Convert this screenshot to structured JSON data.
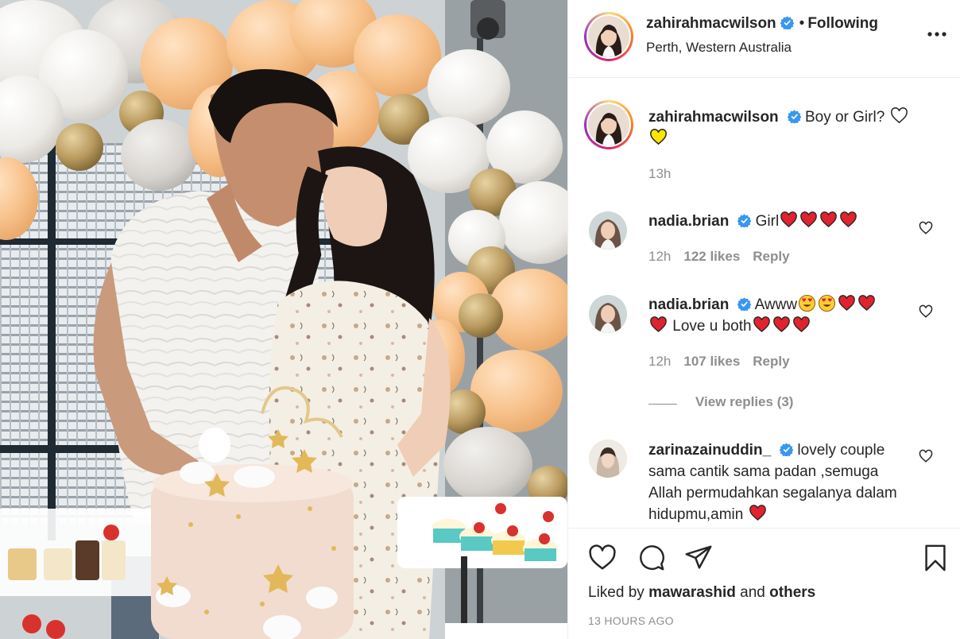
{
  "post": {
    "image_alt": "Couple embracing beside a pastel baby-shower cake and balloon garland"
  },
  "header": {
    "username": "zahirahmacwilson",
    "verified": true,
    "separator": "•",
    "follow_label": "Following",
    "location": "Perth, Western Australia",
    "more_icon": "more-horizontal-icon"
  },
  "caption": {
    "username": "zahirahmacwilson",
    "text": "Boy or Girl?",
    "emojis": [
      "white-heart",
      "yellow-heart"
    ],
    "time": "13h"
  },
  "comments": [
    {
      "username": "nadia.brian",
      "text": "Girl",
      "emojis_after": [
        "red-heart",
        "red-heart",
        "red-heart",
        "red-heart"
      ],
      "time": "12h",
      "likes": "122 likes",
      "reply": "Reply"
    },
    {
      "username": "nadia.brian",
      "text_before": "Awww",
      "emojis_line1": [
        "heart-eyes",
        "heart-eyes",
        "red-heart",
        "red-heart"
      ],
      "text_line2": "Love u both",
      "emojis_line2_before": [
        "red-heart"
      ],
      "emojis_line2_after": [
        "red-heart",
        "red-heart",
        "red-heart"
      ],
      "time": "12h",
      "likes": "107 likes",
      "reply": "Reply"
    },
    {
      "username": "zarinazainuddin_",
      "text": "lovely couple sama cantik sama padan ,semuga Allah permudahkan segalanya dalam hidupmu,amin",
      "emojis_after": [
        "red-heart"
      ]
    }
  ],
  "view_replies": "View replies (3)",
  "actions": {
    "like_icon": "heart-outline-icon",
    "comment_icon": "comment-icon",
    "share_icon": "paper-plane-icon",
    "save_icon": "bookmark-icon"
  },
  "liked_by": {
    "prefix": "Liked by",
    "user": "mawarashid",
    "conj": "and",
    "others": "others"
  },
  "timestamp": "13 HOURS AGO",
  "colors": {
    "verified": "#3897f0",
    "text": "#262626",
    "muted": "#8e8e8e",
    "border": "#efefef"
  }
}
